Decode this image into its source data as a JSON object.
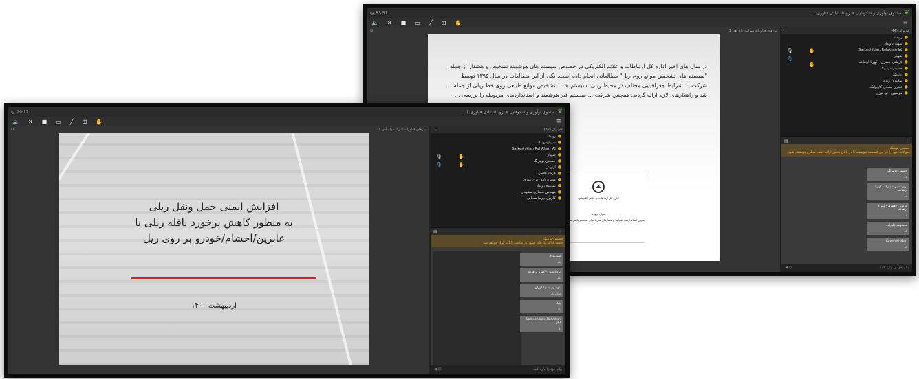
{
  "back_window": {
    "clock": "53:51",
    "title": "صندوق نوآوری و شکوفایی < رویداد تبادل فناوری 1",
    "presentation_header": "نیازهای فناورانه شرکت راه آهن 1",
    "users_header": "کاربران (44)",
    "users": [
      "رویداد",
      "شهباز-رویداد",
      "Sarkeshikian,RahAhan JAI",
      "شهباز",
      "کرمانی جعفری - کهربا ارتفاعه",
      "حسینی-نوتیرنگ",
      "ارتوش",
      "نماینده رویداد",
      "قندری-متعدی-کارپولیک",
      "موسوی - نوا-نوزی",
      "..."
    ],
    "slide_paragraph": "در سال های اخیر اداره کل ارتباطات و علائم الکتریکی در خصوص سیستم های هوشمند تشخیص و هشدار از جمله \"سیستم های تشخیص موانع روی ریل\" مطالعاتی انجام داده است. یکی از این مطالعات در سال ۱۳۹۵ توسط شرکت ... شرایط جغرافیایی مختلف در محیط ریلی، سیستم ها ... تشخیص موانع طبیعی روی خط ریلی از جمله ... شد و راهکارهای لازم ارائه گردید. همچنین شرکت ... سیستم قیر هوشمند و استانداردهای مربوطه را بررسی ...",
    "cover": {
      "org": "اداره کل ارتباطات و علائم الکتریکی",
      "project_label": "عنوان پروژه:",
      "project_title": "تدوین استانداردها، ضوابط و معیارهای فنی اجرای سیستم پایش هوشمند قیر نوین"
    },
    "chat_notice": {
      "name": "حسینی-نوبنیک",
      "text": "سوالات خود را در این قسمت بنویسید تا در پایان بخش ارائه کننده مطرح پرسیده شود"
    },
    "messages": [
      {
        "name": "حسینی-نوتیرنگ",
        "sub": "بله"
      },
      {
        "name": "پرویانشین - شرکت کهربا ارتفاعه",
        "sub": "بله"
      },
      {
        "name": "کرمانی جعفری - کهربا ارتفاعه",
        "sub": "بله"
      },
      {
        "name": "معصومه علیزاده",
        "sub": "بله"
      },
      {
        "name": "Kaveh Khabiri",
        "sub": "بله"
      }
    ],
    "input_placeholder": "پیام خود را وارد کنید"
  },
  "front_window": {
    "clock": "29:17",
    "title": "صندوق نوآوری و شکوفایی < رویداد تبادل فناوری 1",
    "presentation_header": "نیازهای فناورانه شرکت راه آهن 1",
    "users_header": "کاربران (32)",
    "users": [
      "رویداد",
      "شهباز-رویداد",
      "Sarkeshikian,RahAhan JAI",
      "شهباز",
      "حسینی-نوتیرنگ",
      "ارتوش",
      "فرهاد فلاحی",
      "مدیربرنامه ریزی موری",
      "نماینده رویداد",
      "مهندس معماری مشهدی",
      "کارپول-پیرما سحابی"
    ],
    "slide_title_lines": [
      "افزایش ایمنی حمل ونقل ریلی",
      "به منظور کاهش برخورد ناقله ریلی با",
      "عابرین/احشام/خودرو بر روی ریل"
    ],
    "slide_date": "اردیبهشت ۱۴۰۰",
    "chat_notice": {
      "name": "حسینی-نوبنیک",
      "text": "جلسه ارائه نیازهای فناورانه ساعت 10 برگزار خواهد شد"
    },
    "messages": [
      {
        "name": "سیدپوری",
        "sub": "بله"
      },
      {
        "name": "پرویانشین - کهربا ارتفاعه",
        "sub": "بله"
      },
      {
        "name": "موسوی - نوبادلوزان",
        "sub": "سلام بله"
      },
      {
        "name": "یاباد",
        "sub": "بله"
      },
      {
        "name": "Sarkeshikian,RahAhan JAI",
        "sub": "k"
      }
    ],
    "input_placeholder": "پیام خود را وارد کنید"
  }
}
